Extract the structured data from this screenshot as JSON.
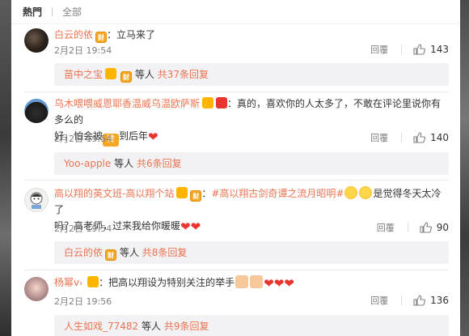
{
  "tabs": {
    "hot": "熱門",
    "all": "全部"
  },
  "comments": [
    {
      "user": "白云的依",
      "text": "：立马来了",
      "time": "2月2日 19:54",
      "reply_label": "回覆",
      "likes": "143",
      "replies": {
        "name": "苗中之宝",
        "etc": "等人",
        "count": "共37条回复"
      }
    },
    {
      "user": "乌木喂喂威恩耶香温威乌温欧萨斯",
      "text_before": "：真的，喜欢你的人太多了，不敢在评论里说你有多么的",
      "text_line2a": "好，怕会被",
      "praise": "赞",
      "text_line2b": "到后年",
      "time": "2月2日 19:54",
      "reply_label": "回覆",
      "likes": "140",
      "replies": {
        "name": "Yoo-apple",
        "etc": "等人",
        "count": "共6条回复"
      }
    },
    {
      "user": "高以翔的英文班-高以翔个站",
      "hashtag": "#高以翔古剑奇谭之流月昭明#",
      "text_after": "是觉得冬天太冷了",
      "text_line2": "吗？高老师，过来我给你暖暖",
      "time": "2月2日 19:54",
      "reply_label": "回覆",
      "likes": "90",
      "replies": {
        "name": "白云的依",
        "etc": "等人",
        "count": "共8条回复"
      }
    },
    {
      "user": "杨幂v",
      "user_suffix": "›",
      "text": "：把高以翔设为特别关注的举手",
      "time": "2月2日 19:56",
      "reply_label": "回覆",
      "likes": "136",
      "replies": {
        "name": "人生如戏_77482",
        "etc": "等人",
        "count": "共9条回复"
      }
    }
  ],
  "icons": {
    "badge_gold": "财",
    "badge_vip": "vip",
    "badge_red": "红",
    "like": "thumb-up-icon"
  },
  "colors": {
    "username": "#eb7350",
    "meta": "#808080",
    "reply_bg": "#f2f2f5"
  }
}
